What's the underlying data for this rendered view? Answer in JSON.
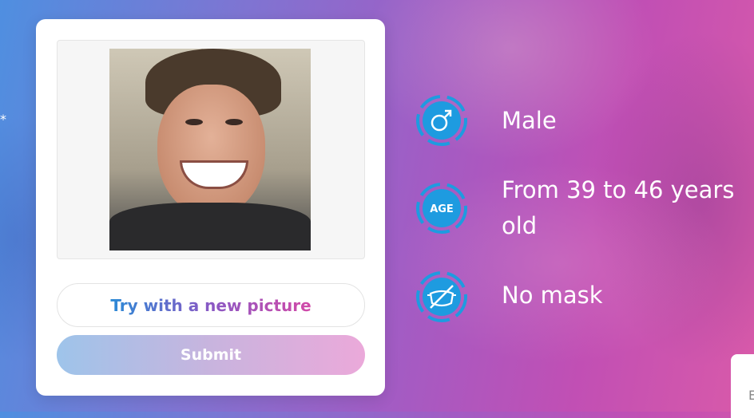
{
  "decor": {
    "star": "*"
  },
  "uploader": {
    "photo_icon": "face-photo",
    "try_label": "Try with a new picture",
    "submit_label": "Submit"
  },
  "results": {
    "gender": {
      "icon": "male-symbol-icon",
      "text": "Male"
    },
    "age": {
      "icon": "age-badge-icon",
      "badge": "AGE",
      "text_line1": "From 39 to 46 years",
      "text_line2": "old"
    },
    "mask": {
      "icon": "mask-off-icon",
      "text": "No mask"
    }
  },
  "corner_tab": {
    "text": "E"
  },
  "colors": {
    "icon_blue": "#1e9be0",
    "gradient_start": "#2b8ad6",
    "gradient_mid": "#8a58c4",
    "gradient_end": "#d24aa8"
  }
}
